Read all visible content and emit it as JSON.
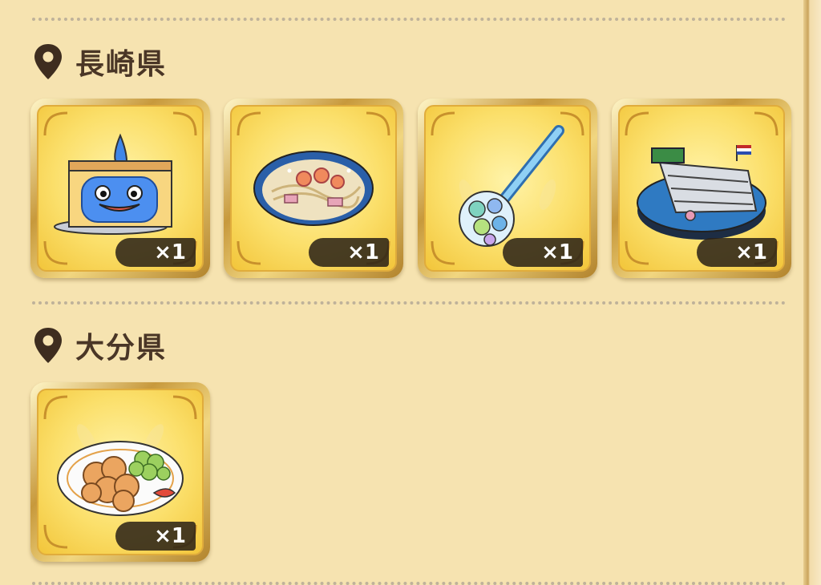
{
  "sections": [
    {
      "region": "長崎県",
      "items": [
        {
          "icon": "slime-castella-cake-icon",
          "quantity": "×1"
        },
        {
          "icon": "champon-noodle-bowl-icon",
          "quantity": "×1"
        },
        {
          "icon": "glass-poppen-icon",
          "quantity": "×1"
        },
        {
          "icon": "harbor-diorama-icon",
          "quantity": "×1"
        }
      ]
    },
    {
      "region": "大分県",
      "items": [
        {
          "icon": "fried-chicken-plate-icon",
          "quantity": "×1"
        }
      ]
    }
  ]
}
